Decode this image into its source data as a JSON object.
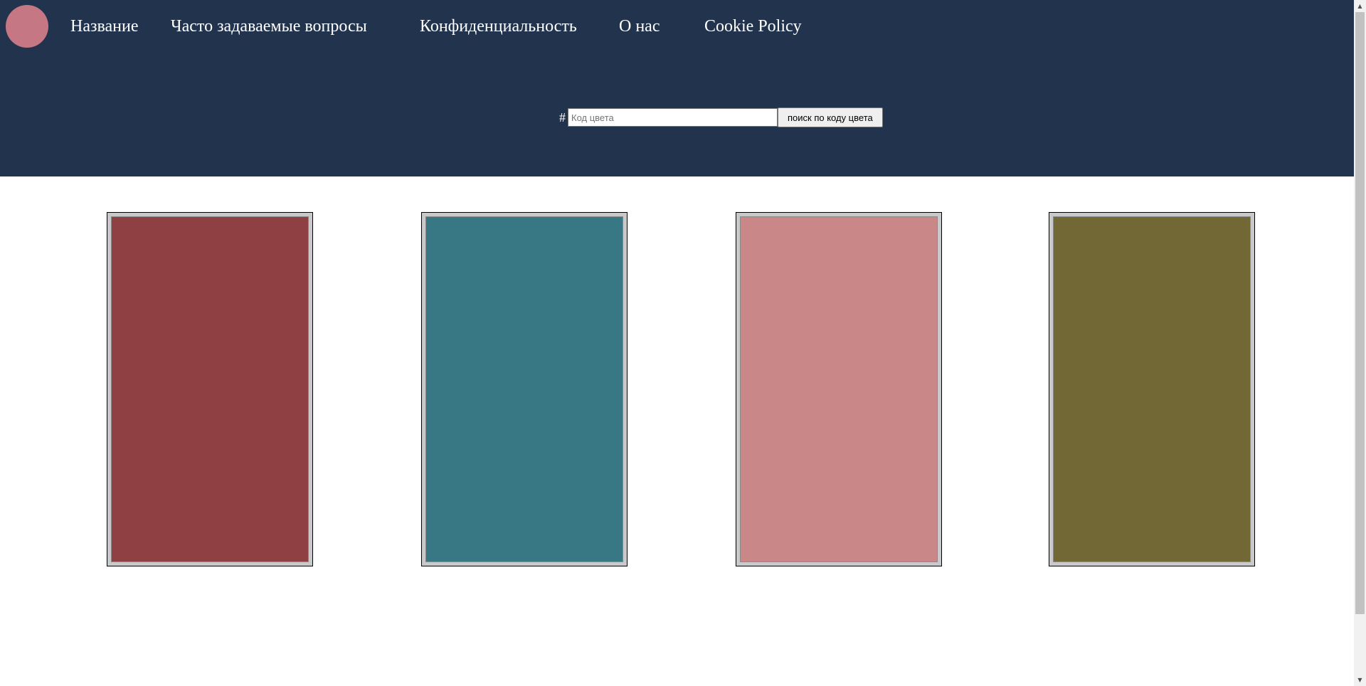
{
  "header": {
    "logo_color": "#c67784",
    "background_color": "#22344d",
    "nav": [
      {
        "label": "Название"
      },
      {
        "label": "Часто задаваемые вопросы"
      },
      {
        "label": "Конфиденциальность"
      },
      {
        "label": "О нас"
      },
      {
        "label": "Cookie Policy"
      }
    ]
  },
  "search": {
    "prefix": "#",
    "placeholder": "Код цвета",
    "value": "",
    "button_label": "поиск по коду цвета"
  },
  "swatches": [
    {
      "color": "#8f4042"
    },
    {
      "color": "#387884"
    },
    {
      "color": "#c98788"
    },
    {
      "color": "#726835"
    }
  ],
  "scrollbar": {
    "up_icon": "arrow-up-icon",
    "down_icon": "arrow-down-icon"
  }
}
